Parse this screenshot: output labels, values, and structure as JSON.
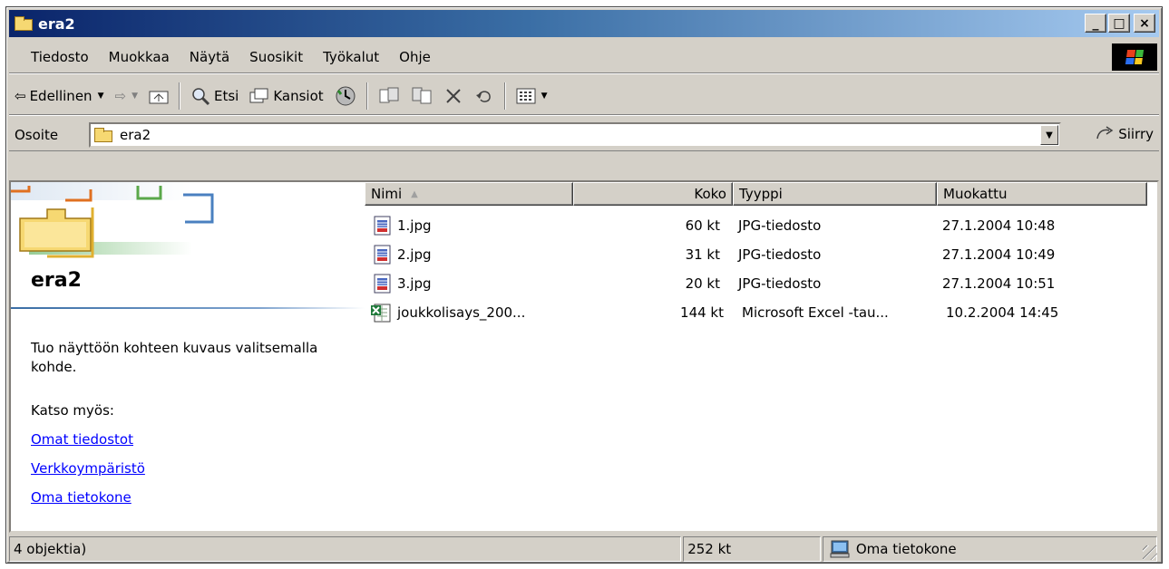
{
  "window": {
    "title": "era2",
    "minimize": "_",
    "maximize": "□",
    "close": "×"
  },
  "menu": [
    "Tiedosto",
    "Muokkaa",
    "Näytä",
    "Suosikit",
    "Työkalut",
    "Ohje"
  ],
  "toolbar": {
    "back": "Edellinen",
    "search": "Etsi",
    "folders": "Kansiot"
  },
  "address": {
    "label": "Osoite",
    "value": "era2",
    "go": "Siirry"
  },
  "leftpane": {
    "folder_title": "era2",
    "description": "Tuo näyttöön kohteen kuvaus valitsemalla kohde.",
    "see_also": "Katso myös:",
    "links": [
      "Omat tiedostot",
      "Verkkoympäristö",
      "Oma tietokone"
    ]
  },
  "columns": {
    "name": "Nimi",
    "size": "Koko",
    "type": "Tyyppi",
    "modified": "Muokattu"
  },
  "files": [
    {
      "name": "1.jpg",
      "size": "60 kt",
      "type": "JPG-tiedosto",
      "modified": "27.1.2004 10:48",
      "icon": "jpg-file-icon"
    },
    {
      "name": "2.jpg",
      "size": "31 kt",
      "type": "JPG-tiedosto",
      "modified": "27.1.2004 10:49",
      "icon": "jpg-file-icon"
    },
    {
      "name": "3.jpg",
      "size": "20 kt",
      "type": "JPG-tiedosto",
      "modified": "27.1.2004 10:51",
      "icon": "jpg-file-icon"
    },
    {
      "name": "joukkolisays_200...",
      "size": "144 kt",
      "type": "Microsoft Excel -tau...",
      "modified": "10.2.2004 14:45",
      "icon": "excel-file-icon"
    }
  ],
  "status": {
    "objects": "4 objektia)",
    "size": "252 kt",
    "zone": "Oma tietokone"
  },
  "colors": {
    "title_gradient_start": "#0a246a",
    "title_gradient_end": "#a6caf0",
    "chrome": "#d4d0c8",
    "link": "#0000ff"
  }
}
